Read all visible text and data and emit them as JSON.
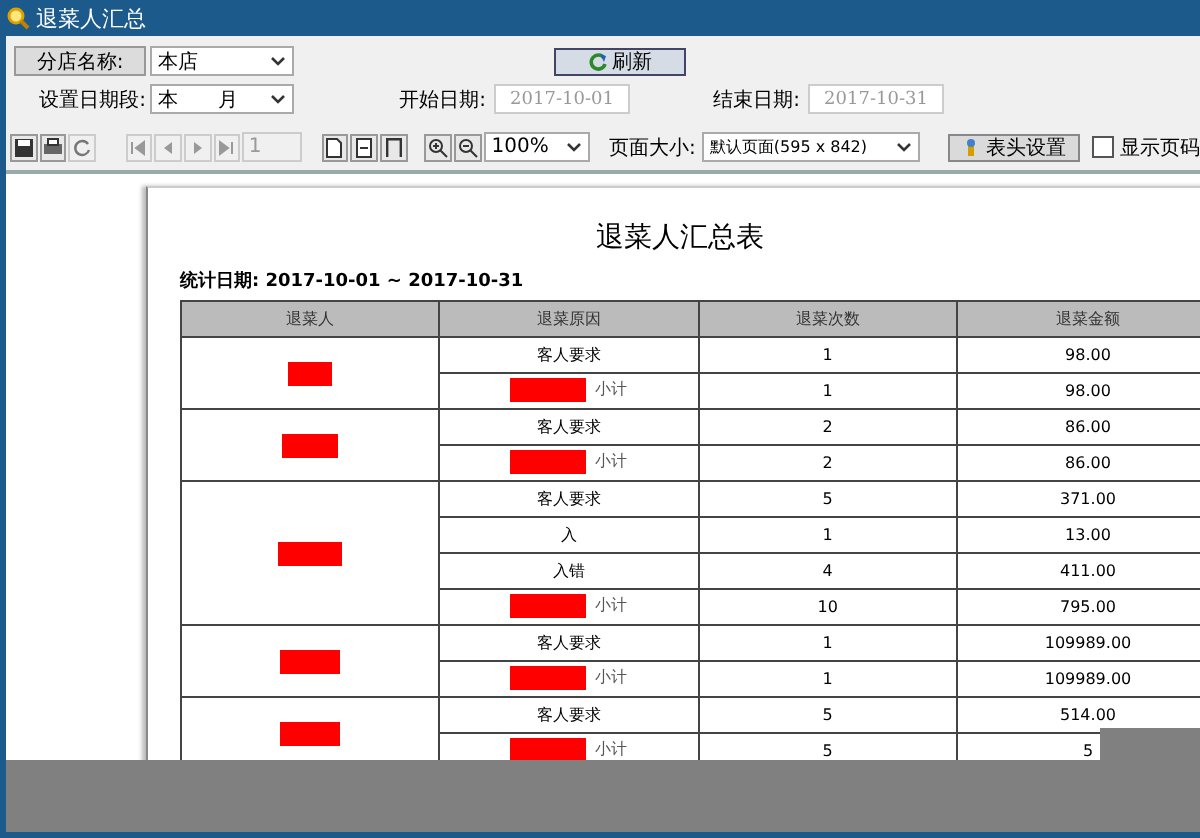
{
  "window": {
    "title": "退菜人汇总"
  },
  "filters": {
    "branch_label": "分店名称:",
    "branch": "本店",
    "period_label": "设置日期段:",
    "period": "本　　月",
    "start_label": "开始日期:",
    "start": "2017-10-01",
    "end_label": "结束日期:",
    "end": "2017-10-31",
    "refresh": "刷新"
  },
  "toolbar": {
    "page": "1",
    "zoom": "100%",
    "page_size_label": "页面大小:",
    "page_size": "默认页面(595 x 842)",
    "header_button": "表头设置",
    "show_page_numbers": {
      "label": "显示页码",
      "checked": false
    }
  },
  "report": {
    "title": "退菜人汇总表",
    "date_range": "统计日期: 2017-10-01 ~ 2017-10-31",
    "columns": [
      "退菜人",
      "退菜原因",
      "退菜次数",
      "退菜金额"
    ],
    "groups": [
      {
        "rows": [
          {
            "kind": "item",
            "reason": "客人要求",
            "count": "1",
            "amount": "98.00"
          },
          {
            "kind": "subtotal",
            "reason": "小计",
            "count": "1",
            "amount": "98.00"
          }
        ]
      },
      {
        "rows": [
          {
            "kind": "item",
            "reason": "客人要求",
            "count": "2",
            "amount": "86.00"
          },
          {
            "kind": "subtotal",
            "reason": "小计",
            "count": "2",
            "amount": "86.00"
          }
        ]
      },
      {
        "rows": [
          {
            "kind": "item",
            "reason": "客人要求",
            "count": "5",
            "amount": "371.00"
          },
          {
            "kind": "item",
            "reason": "入",
            "count": "1",
            "amount": "13.00"
          },
          {
            "kind": "item",
            "reason": "入错",
            "count": "4",
            "amount": "411.00"
          },
          {
            "kind": "subtotal",
            "reason": "小计",
            "count": "10",
            "amount": "795.00"
          }
        ]
      },
      {
        "rows": [
          {
            "kind": "item",
            "reason": "客人要求",
            "count": "1",
            "amount": "109989.00"
          },
          {
            "kind": "subtotal",
            "reason": "小计",
            "count": "1",
            "amount": "109989.00"
          }
        ]
      },
      {
        "rows": [
          {
            "kind": "item",
            "reason": "客人要求",
            "count": "5",
            "amount": "514.00"
          },
          {
            "kind": "subtotal",
            "reason": "小计",
            "count": "5",
            "amount": "5"
          }
        ]
      }
    ]
  }
}
